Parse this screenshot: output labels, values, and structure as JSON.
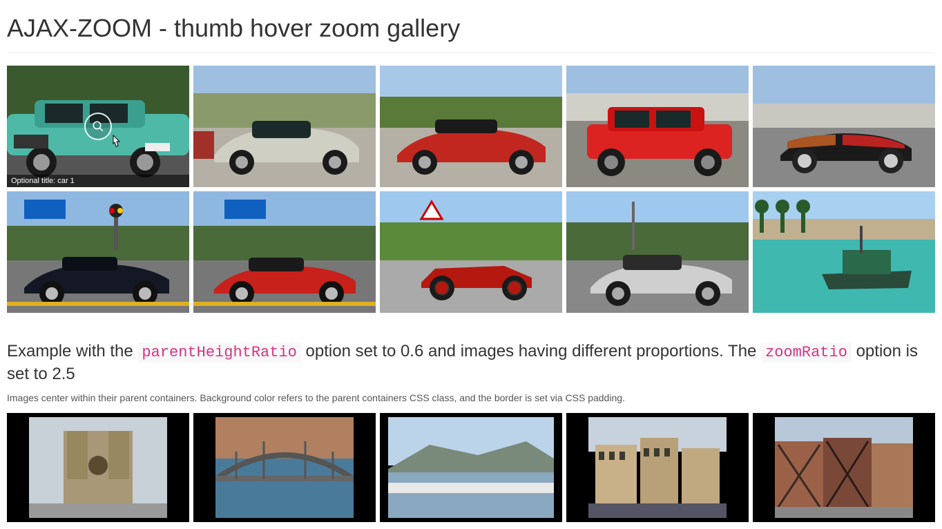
{
  "title": "AJAX-ZOOM - thumb hover zoom gallery",
  "hover": {
    "caption_prefix": "Optional title: ",
    "caption_value": "car 1"
  },
  "example": {
    "text_before_code1": "Example with the ",
    "code1": "parentHeightRatio",
    "text_mid": " option set to 0.6 and images having different proportions. The ",
    "code2": "zoomRatio",
    "text_after_code2": " option is set to 2.5"
  },
  "subnote": "Images center within their parent containers. Background color refers to the parent containers CSS class, and the border is set via CSS padding.",
  "gallery1": [
    {
      "name": "car-1-teal-sedan"
    },
    {
      "name": "car-2-silver-mustang"
    },
    {
      "name": "car-3-red-mustang-convertible"
    },
    {
      "name": "car-4-red-toyota-sedan"
    },
    {
      "name": "car-5-black-red-vintage-convertible"
    },
    {
      "name": "car-6-dark-blue-jaguar"
    },
    {
      "name": "car-7-red-alfa-coupe"
    },
    {
      "name": "car-8-red-vintage-racer"
    },
    {
      "name": "car-9-silver-rolls-royce"
    },
    {
      "name": "boat-10-harbor"
    }
  ],
  "gallery2": [
    {
      "name": "photo-1-cathedral"
    },
    {
      "name": "photo-2-bridge"
    },
    {
      "name": "photo-3-marina-mountains"
    },
    {
      "name": "photo-4-palace-buildings"
    },
    {
      "name": "photo-5-timber-houses"
    }
  ]
}
